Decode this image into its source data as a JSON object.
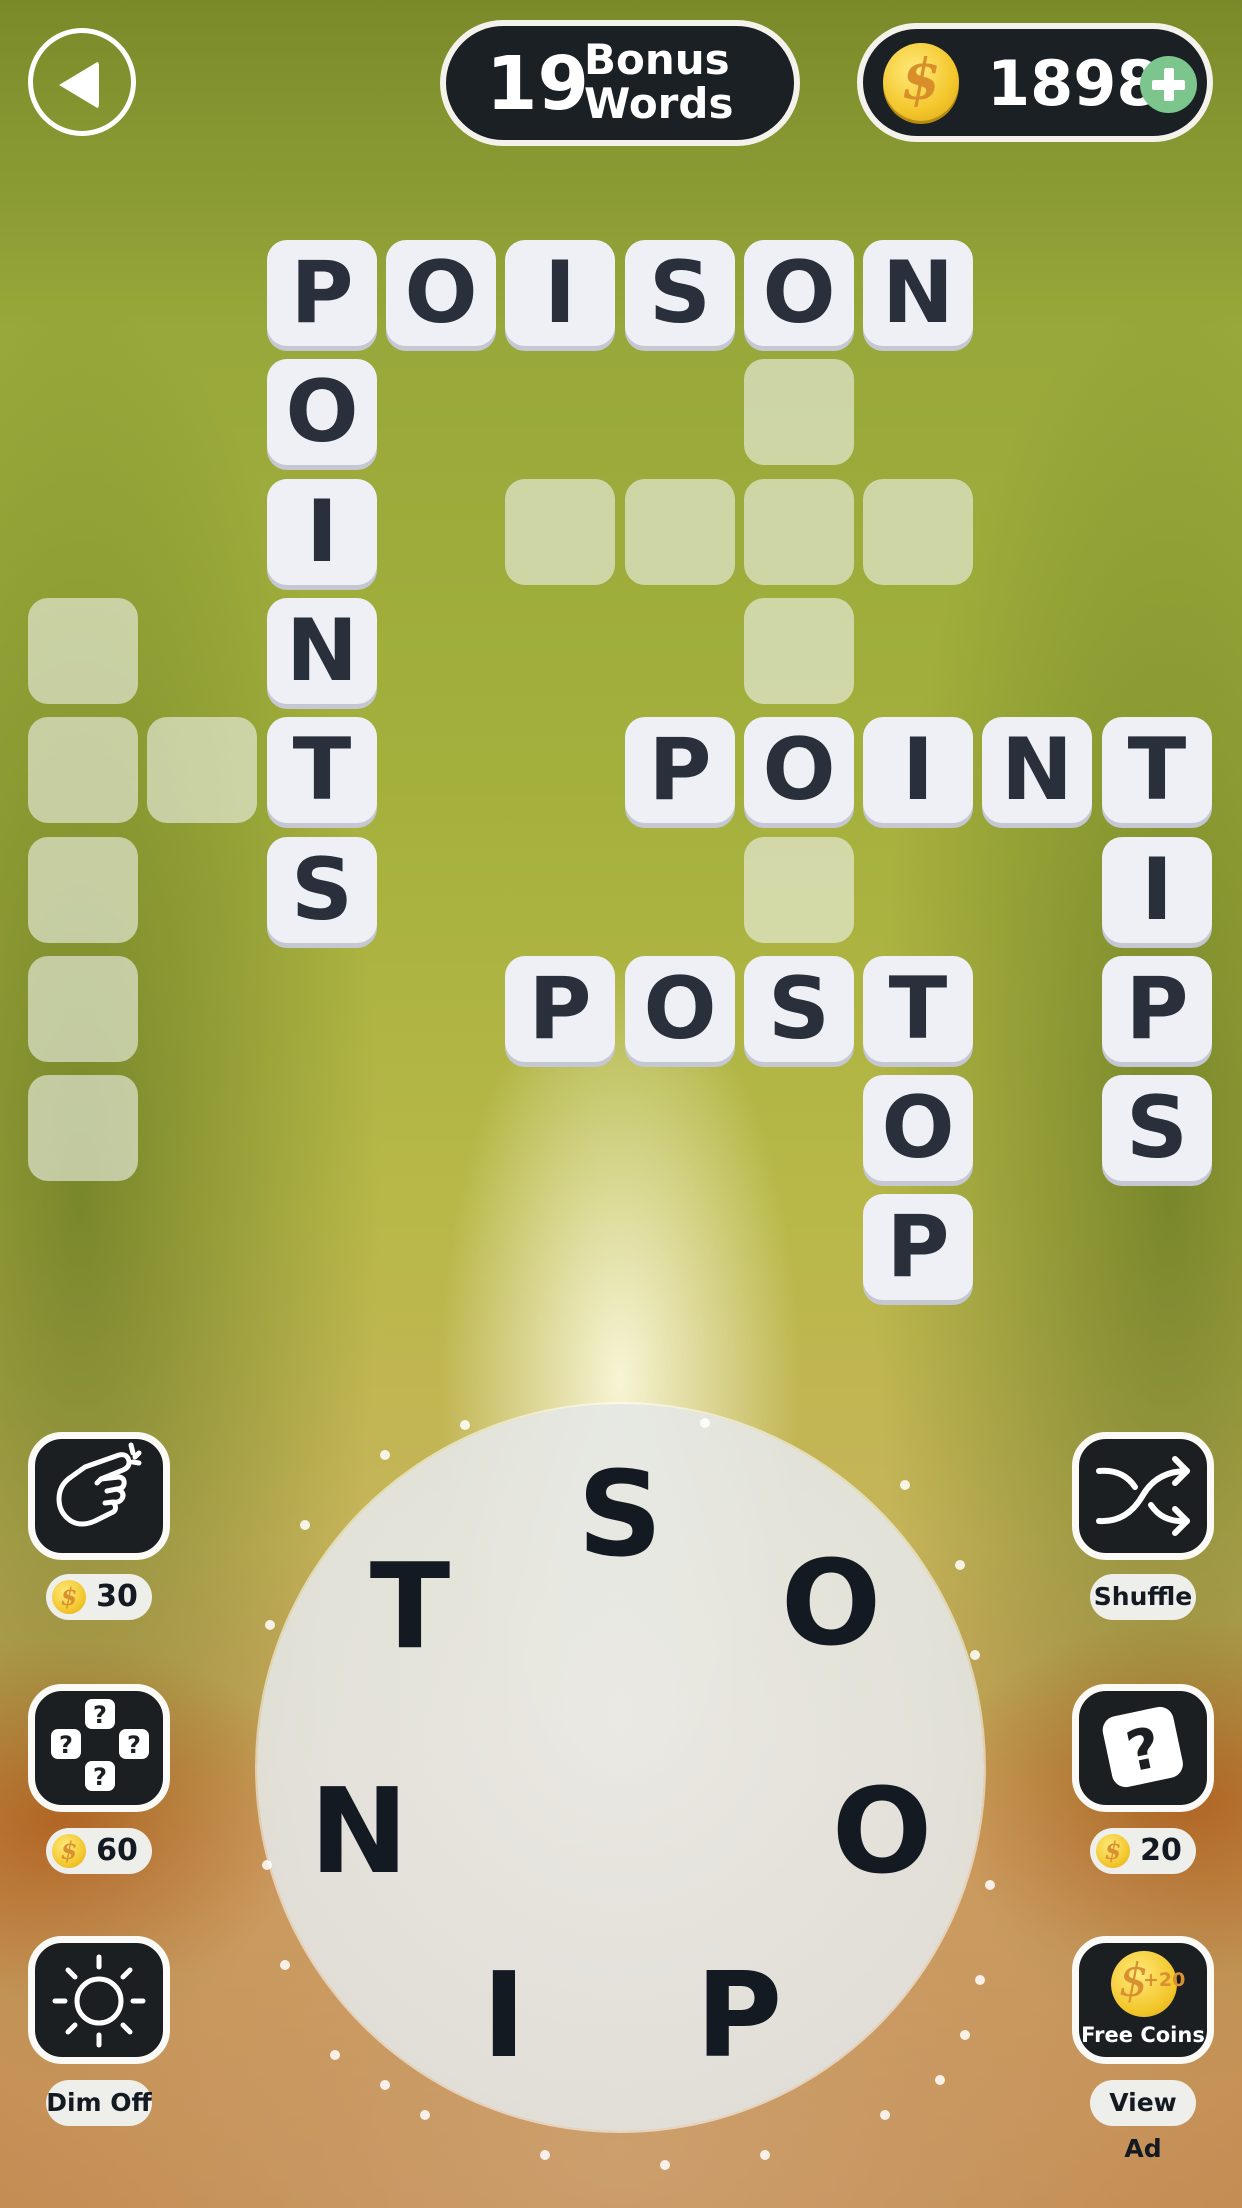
{
  "header": {
    "back_icon": "back-arrow-icon",
    "bonus_words": {
      "count": "19",
      "label_line1": "Bonus",
      "label_line2": "Words"
    },
    "coins": {
      "icon": "coin-icon",
      "value": "1898",
      "add_icon": "plus-icon",
      "add_color": "#7cc58d"
    }
  },
  "grid": {
    "rows": [
      [
        null,
        null,
        "P",
        "O",
        "I",
        "S",
        "O",
        "N",
        null,
        null
      ],
      [
        null,
        null,
        "O",
        null,
        null,
        null,
        "",
        null,
        null,
        null
      ],
      [
        null,
        null,
        "I",
        null,
        "",
        "",
        "",
        "",
        null,
        null
      ],
      [
        "",
        null,
        "N",
        null,
        null,
        null,
        "",
        null,
        null,
        null
      ],
      [
        "",
        "",
        "T",
        null,
        null,
        "P",
        "O",
        "I",
        "N",
        "T"
      ],
      [
        "",
        null,
        "S",
        null,
        null,
        null,
        "",
        null,
        null,
        "I"
      ],
      [
        "",
        null,
        null,
        null,
        "P",
        "O",
        "S",
        "T",
        null,
        "P"
      ],
      [
        "",
        null,
        null,
        null,
        null,
        null,
        null,
        "O",
        null,
        "S"
      ],
      [
        null,
        null,
        null,
        null,
        null,
        null,
        null,
        "P",
        null,
        null
      ]
    ],
    "found_words": [
      "POISON",
      "POINTS",
      "POINT",
      "TIPS",
      "POST",
      "TOP"
    ]
  },
  "wheel": {
    "letters": [
      "S",
      "O",
      "O",
      "P",
      "I",
      "N",
      "T"
    ]
  },
  "left_buttons": [
    {
      "name": "hint-finger",
      "icon": "tap-finger-icon",
      "cost": "30"
    },
    {
      "name": "multi-reveal",
      "icon": "question-cluster-icon",
      "cost": "60"
    },
    {
      "name": "dim",
      "icon": "sun-icon",
      "label": "Dim Off"
    }
  ],
  "right_buttons": [
    {
      "name": "shuffle",
      "icon": "shuffle-icon",
      "label": "Shuffle"
    },
    {
      "name": "reveal-letter",
      "icon": "question-tile-icon",
      "cost": "20"
    },
    {
      "name": "free-coins",
      "icon": "coin-plus-icon",
      "coin_text": "+20",
      "inner_label": "Free Coins",
      "label": "View Ad"
    }
  ],
  "colors": {
    "tile": "#eef0f6",
    "tile_text": "#2a2f3c",
    "button_bg": "#1b1f22",
    "coin_gold": "#f3c72c"
  }
}
